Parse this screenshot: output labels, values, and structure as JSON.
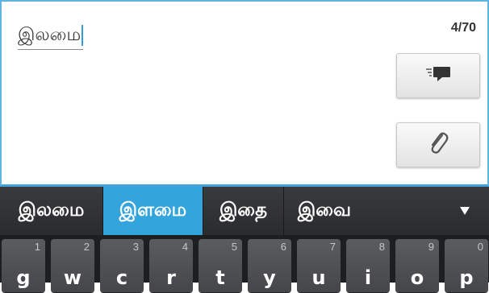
{
  "compose": {
    "message_text": "இலமை",
    "char_counter": "4/70",
    "send_icon": "send-message-icon",
    "attach_icon": "paperclip-icon"
  },
  "keyboard": {
    "suggestions": [
      {
        "label": "இலமை",
        "highlighted": false
      },
      {
        "label": "இளமை",
        "highlighted": true
      },
      {
        "label": "இதை",
        "highlighted": false
      },
      {
        "label": "இவை",
        "highlighted": false
      }
    ],
    "expand_icon": "triangle-down-icon",
    "keys": [
      {
        "number": "1",
        "glyph": "g"
      },
      {
        "number": "2",
        "glyph": "w"
      },
      {
        "number": "3",
        "glyph": "c"
      },
      {
        "number": "4",
        "glyph": "r"
      },
      {
        "number": "5",
        "glyph": "t"
      },
      {
        "number": "6",
        "glyph": "y"
      },
      {
        "number": "7",
        "glyph": "u"
      },
      {
        "number": "8",
        "glyph": "i"
      },
      {
        "number": "9",
        "glyph": "o"
      },
      {
        "number": "0",
        "glyph": "p"
      }
    ]
  },
  "colors": {
    "accent": "#34a4dc",
    "keyboard_bg": "#1d1e20",
    "key_bg": "#515256"
  }
}
